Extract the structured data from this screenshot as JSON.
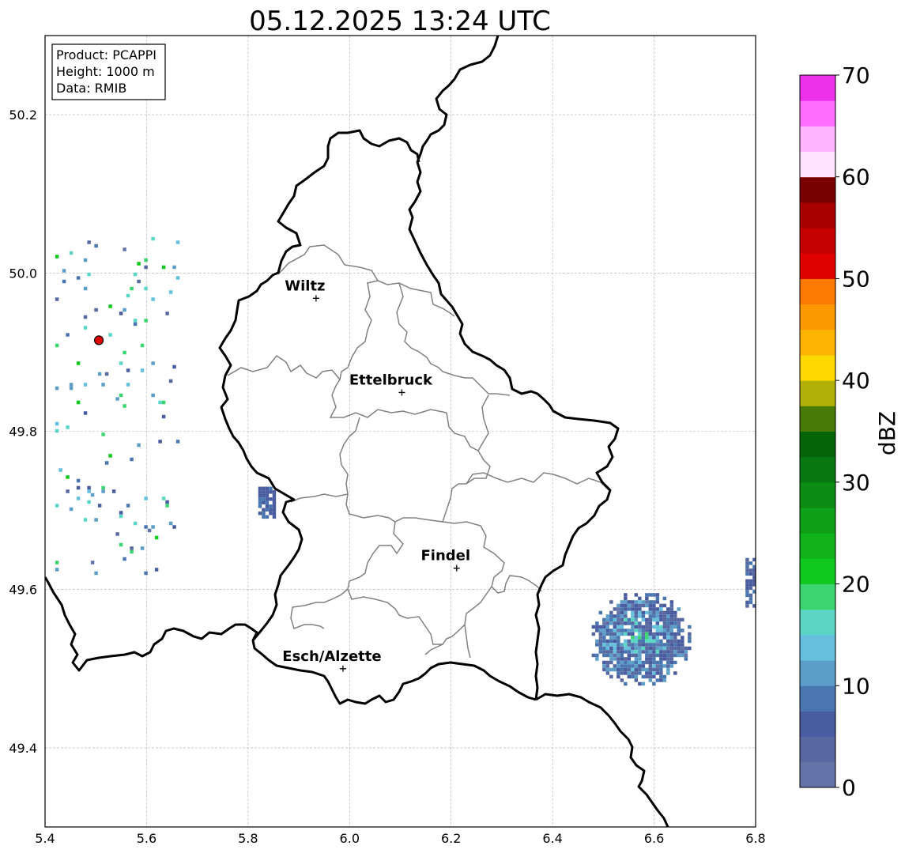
{
  "title": "05.12.2025 13:24 UTC",
  "info_box": [
    "Product: PCAPPI",
    "Height: 1000 m",
    "Data: RMIB"
  ],
  "axes": {
    "xlim": [
      5.4,
      6.8
    ],
    "ylim": [
      49.3,
      50.3
    ],
    "xticks": [
      "5.4",
      "5.6",
      "5.8",
      "6.0",
      "6.2",
      "6.4",
      "6.6",
      "6.8"
    ],
    "yticks": [
      "49.4",
      "49.6",
      "49.8",
      "50.0",
      "50.2"
    ],
    "grid": true
  },
  "colorbar": {
    "label": "dBZ",
    "range": [
      0,
      70
    ],
    "ticks": [
      "0",
      "10",
      "20",
      "30",
      "40",
      "50",
      "60",
      "70"
    ],
    "colors": [
      "#6474a8",
      "#5868a0",
      "#4a5ca0",
      "#4a76b0",
      "#5c9ec8",
      "#64c0dc",
      "#5cd6c4",
      "#3cd470",
      "#10c81e",
      "#10b41a",
      "#0ea016",
      "#0c8c12",
      "#087810",
      "#046408",
      "#487a08",
      "#b0b008",
      "#fcd800",
      "#fcb400",
      "#fc9800",
      "#fc7a00",
      "#e00000",
      "#c40000",
      "#a80000",
      "#780000",
      "#ffe2ff",
      "#ffb4ff",
      "#ff6cff",
      "#ec30ec"
    ]
  },
  "cities": [
    {
      "name": "Wiltz",
      "lon": 5.934,
      "lat": 49.968
    },
    {
      "name": "Ettelbruck",
      "lon": 6.103,
      "lat": 49.849
    },
    {
      "name": "Findel",
      "lon": 6.211,
      "lat": 49.627
    },
    {
      "name": "Esch/Alzette",
      "lon": 5.987,
      "lat": 49.5
    }
  ],
  "radar_site": {
    "lon": 5.506,
    "lat": 49.915,
    "color": "#e00000"
  },
  "colors": {
    "border": "#000000",
    "canton": "#808080",
    "grid": "#b0b0b0"
  },
  "echo_regions": [
    {
      "label": "southeast cell",
      "lon": [
        6.47,
        6.67
      ],
      "lat": [
        49.48,
        49.6
      ],
      "dbz_range": [
        2,
        20
      ]
    },
    {
      "label": "east edge",
      "lon": [
        6.78,
        6.8
      ],
      "lat": [
        49.58,
        49.64
      ],
      "dbz_range": [
        4,
        10
      ]
    },
    {
      "label": "western echoes",
      "lon": [
        5.42,
        5.66
      ],
      "lat": [
        49.62,
        50.05
      ],
      "dbz_range": [
        2,
        22
      ]
    },
    {
      "label": "clutter near border",
      "lon": [
        5.82,
        5.85
      ],
      "lat": [
        49.69,
        49.73
      ],
      "dbz_range": [
        5,
        9
      ]
    }
  ]
}
